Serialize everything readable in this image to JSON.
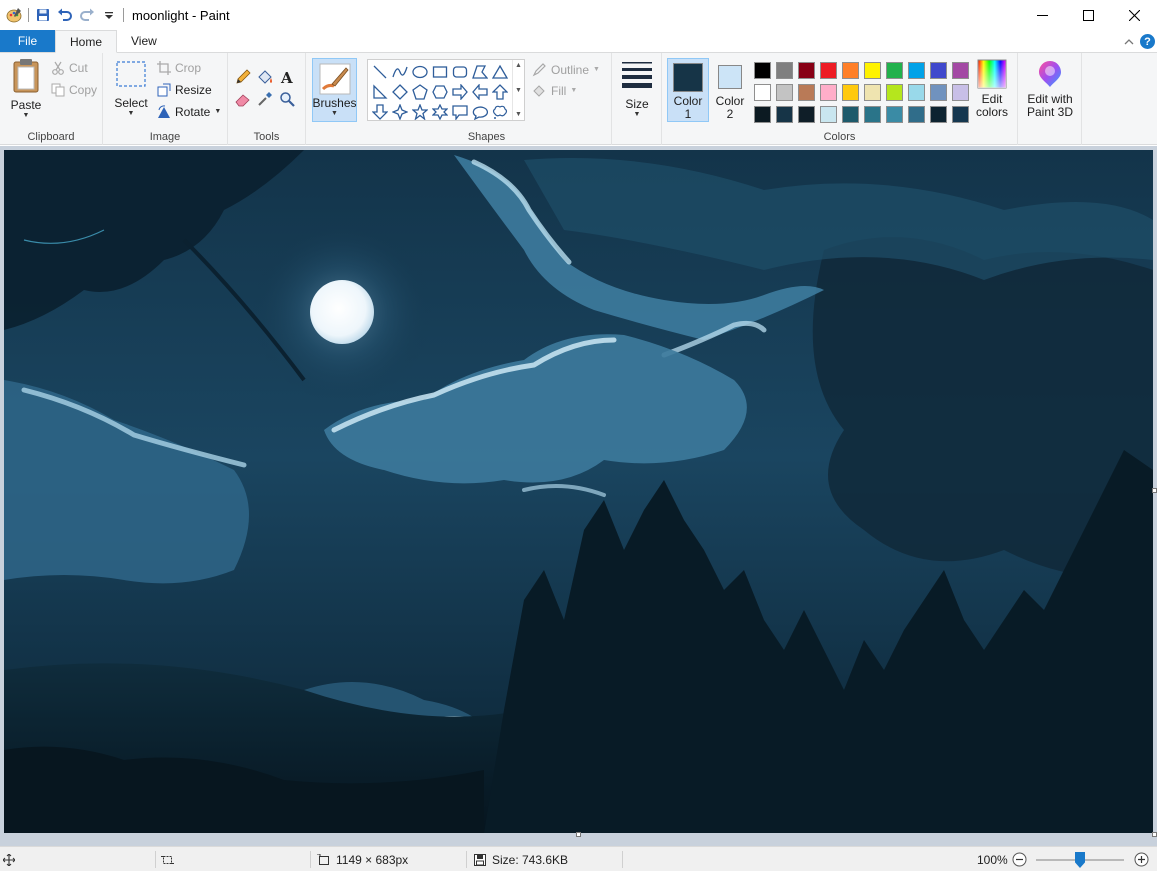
{
  "window": {
    "title": "moonlight - Paint",
    "app_icon": "paint-palette-icon"
  },
  "quick_access": {
    "save_icon": "save-icon",
    "undo_icon": "undo-icon",
    "redo_icon": "redo-icon",
    "customize_icon": "dropdown-arrow-icon"
  },
  "tabs": {
    "file": "File",
    "home": "Home",
    "view": "View"
  },
  "ribbon": {
    "clipboard": {
      "label": "Clipboard",
      "paste": "Paste",
      "cut": "Cut",
      "copy": "Copy"
    },
    "image": {
      "label": "Image",
      "select": "Select",
      "crop": "Crop",
      "resize": "Resize",
      "rotate": "Rotate"
    },
    "tools": {
      "label": "Tools",
      "items": [
        "pencil-icon",
        "fill-bucket-icon",
        "text-icon",
        "eraser-icon",
        "color-picker-icon",
        "magnifier-icon"
      ]
    },
    "brushes": {
      "label": "Brushes"
    },
    "shapes": {
      "label": "Shapes",
      "outline": "Outline",
      "fill": "Fill"
    },
    "size": {
      "label": "Size"
    },
    "colors": {
      "label": "Colors",
      "color1_label": "Color",
      "color1_num": "1",
      "color2_label": "Color",
      "color2_num": "2",
      "color1_value": "#163447",
      "color2_value": "#cce4f7",
      "edit_colors_line1": "Edit",
      "edit_colors_line2": "colors",
      "palette": [
        "#000000",
        "#7f7f7f",
        "#880015",
        "#ed1c24",
        "#ff7f27",
        "#fff200",
        "#22b14c",
        "#00a2e8",
        "#3f48cc",
        "#a349a4",
        "#ffffff",
        "#c3c3c3",
        "#b97a57",
        "#ffaec9",
        "#ffc90e",
        "#efe4b0",
        "#b5e61d",
        "#99d9ea",
        "#7092be",
        "#c8bfe7",
        "#0c1a22",
        "#163447",
        "#0f1e28",
        "#c9e6ef",
        "#1d5a6b",
        "#2a7489",
        "#3a8ba5",
        "#306d8a",
        "#0d2330",
        "#15374f"
      ]
    },
    "paint3d": {
      "line1": "Edit with",
      "line2": "Paint 3D"
    }
  },
  "status": {
    "dimensions": "1149 × 683px",
    "size": "Size: 743.6KB",
    "zoom": "100%",
    "zoom_level": 0.5
  }
}
